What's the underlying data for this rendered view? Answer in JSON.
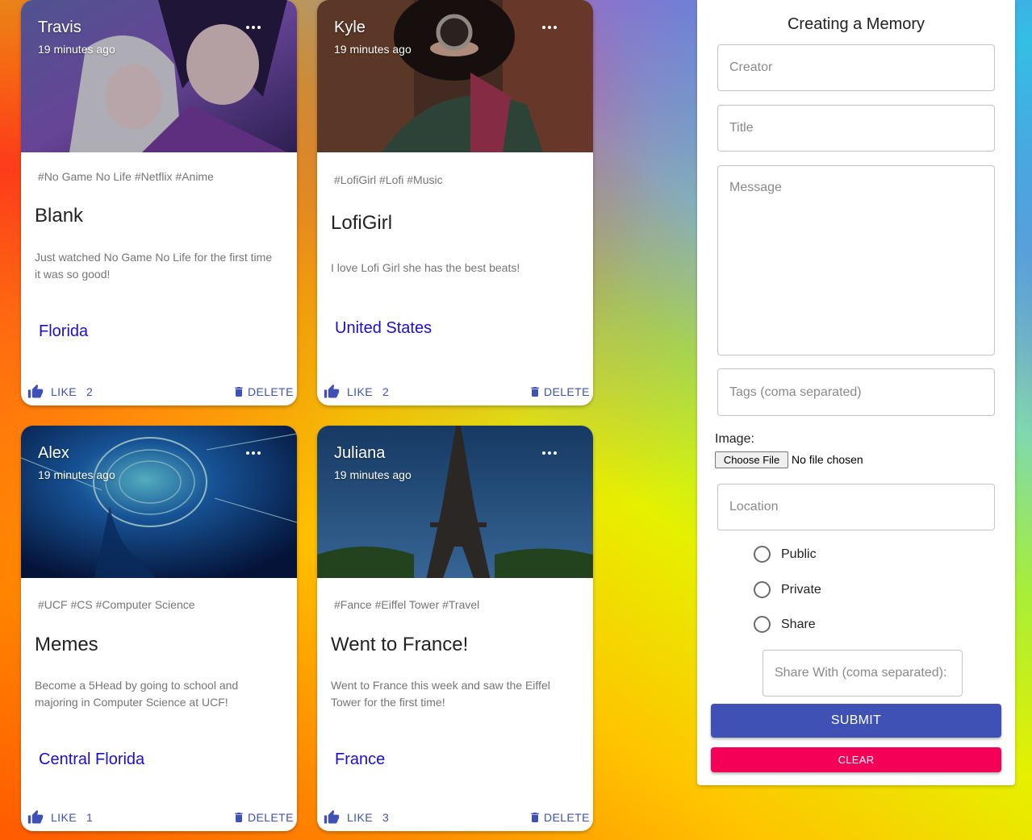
{
  "posts": [
    {
      "creator": "Travis",
      "time": "19 minutes ago",
      "tags": "#No Game No Life #Netflix #Anime",
      "title": "Blank",
      "message": "Just watched No Game No Life for the first time it was so good!",
      "location": "Florida",
      "like_label": "LIKE",
      "like_count": "2",
      "delete_label": "DELETE"
    },
    {
      "creator": "Kyle",
      "time": "19 minutes ago",
      "tags": "#LofiGirl #Lofi #Music",
      "title": "LofiGirl",
      "message": "I love Lofi Girl she has the best beats!",
      "location": "United States",
      "like_label": "LIKE",
      "like_count": "2",
      "delete_label": "DELETE"
    },
    {
      "creator": "Alex",
      "time": "19 minutes ago",
      "tags": "#UCF #CS #Computer Science",
      "title": "Memes",
      "message": "Become a 5Head by going to school and majoring in Computer Science at UCF!",
      "location": "Central Florida",
      "like_label": "LIKE",
      "like_count": "1",
      "delete_label": "DELETE"
    },
    {
      "creator": "Juliana",
      "time": "19 minutes ago",
      "tags": "#Fance #Eiffel Tower #Travel",
      "title": "Went to France!",
      "message": "Went to France this week and saw the Eiffel Tower for the first time!",
      "location": "France",
      "like_label": "LIKE",
      "like_count": "3",
      "delete_label": "DELETE"
    }
  ],
  "form": {
    "heading": "Creating a Memory",
    "creator_placeholder": "Creator",
    "title_placeholder": "Title",
    "message_placeholder": "Message",
    "tags_placeholder": "Tags (coma separated)",
    "image_label": "Image:",
    "choose_file_label": "Choose File",
    "file_status": "No file chosen",
    "location_placeholder": "Location",
    "visibility_options": [
      "Public",
      "Private",
      "Share"
    ],
    "share_with_placeholder": "Share With (coma separated):",
    "submit_label": "SUBMIT",
    "clear_label": "CLEAR"
  },
  "colors": {
    "primary": "#3f51b5",
    "secondary": "#f50057",
    "location_link": "#1a0dd6"
  },
  "icons": {
    "like": "thumb-up-icon",
    "delete": "trash-icon",
    "more": "more-horizontal-icon"
  }
}
